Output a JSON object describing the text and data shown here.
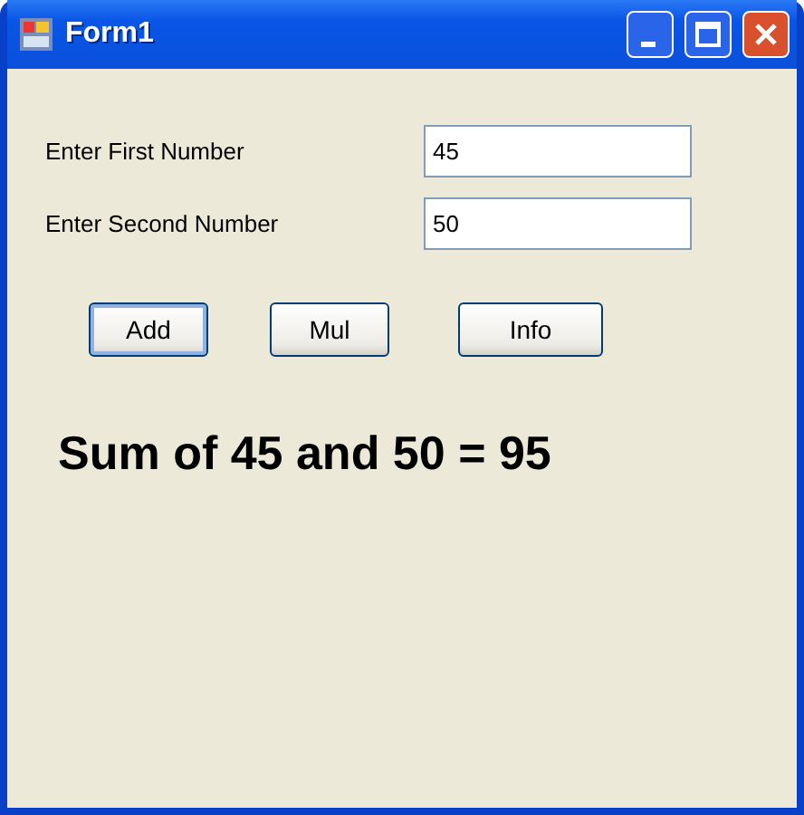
{
  "window": {
    "title": "Form1"
  },
  "fields": [
    {
      "label": "Enter First Number",
      "value": "45"
    },
    {
      "label": "Enter Second Number",
      "value": "50"
    }
  ],
  "buttons": [
    {
      "label": "Add",
      "focused": true
    },
    {
      "label": "Mul",
      "focused": false
    },
    {
      "label": "Info",
      "focused": false
    }
  ],
  "result": "Sum of 45 and 50 = 95"
}
